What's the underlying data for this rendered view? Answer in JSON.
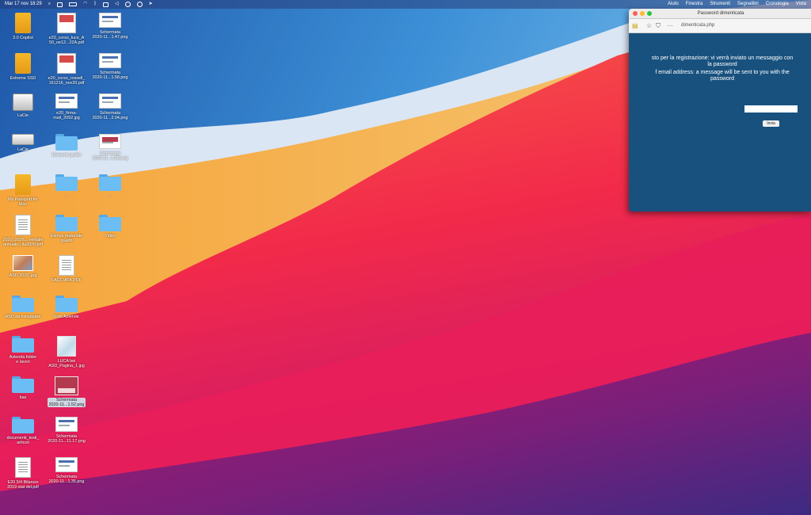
{
  "menubar": {
    "left_items": [
      {
        "name": "datetime",
        "label": "Mar 17 nov 18:29"
      },
      {
        "name": "spotlight-icon"
      },
      {
        "name": "control-center-icon"
      },
      {
        "name": "battery-icon"
      },
      {
        "name": "wifi-icon"
      },
      {
        "name": "bluetooth-icon"
      },
      {
        "name": "screen-mirror-icon"
      },
      {
        "name": "volume-icon"
      },
      {
        "name": "user-icon"
      },
      {
        "name": "focus-icon"
      },
      {
        "name": "location-icon"
      }
    ],
    "menus": [
      "Aiuto",
      "Finestra",
      "Strumenti",
      "Segnalibri",
      "Cronologia",
      "Vista"
    ]
  },
  "desktop_icons": [
    {
      "name": "icon-3d-copilot",
      "kind": "drive",
      "label": "3.0 Copilot"
    },
    {
      "name": "icon-extreme-ssd",
      "kind": "drive",
      "label": "Extreme SSD"
    },
    {
      "name": "icon-lacie-1",
      "kind": "lacie",
      "label": "LaCie"
    },
    {
      "name": "icon-lacie-2",
      "kind": "lacie2",
      "label": "LaCie"
    },
    {
      "name": "icon-my-passport",
      "kind": "drive",
      "label": "My Passport for\nMac"
    },
    {
      "name": "icon-verbale-pdf",
      "kind": "doc",
      "label": "2020_2026... verbale\nannuale...lla2020.pdf"
    },
    {
      "name": "icon-asd-2020-jpg",
      "kind": "photo",
      "label": "ASD 2020 .jpg"
    },
    {
      "name": "icon-asd-sviluppo",
      "kind": "folder",
      "label": "ASD da sviluppare"
    },
    {
      "name": "icon-azienda-folder",
      "kind": "folder",
      "label": "Azienda folder\ne lavori"
    },
    {
      "name": "icon-bas",
      "kind": "folder",
      "label": "bas"
    },
    {
      "name": "icon-documenti-testi",
      "kind": "folder",
      "label": "documenti_testi_\narticoli"
    },
    {
      "name": "icon-e20-bilancio",
      "kind": "doc",
      "label": "E20 5/4 Bilancio\n2019 stat del.pdf"
    },
    {
      "name": "icon-corso-luce-pdf",
      "kind": "pdf",
      "label": "e20_corso_luce_A\n50_oe12...22A.pdf"
    },
    {
      "name": "icon-corso-rossi-pdf",
      "kind": "pdf",
      "label": "e20_corso_rossell_\n161216_nov20.pdf"
    },
    {
      "name": "icon-firma-jpg",
      "kind": "shot",
      "label": "e20_firma-\nmail_2092.jpg"
    },
    {
      "name": "icon-elementi-grafici",
      "kind": "folder",
      "label": "Elementi grafici"
    },
    {
      "name": "icon-folder-a",
      "kind": "folder",
      "label": "..."
    },
    {
      "name": "icon-elenco-materiale",
      "kind": "folder",
      "label": "Elenco materiale\nquadri"
    },
    {
      "name": "icon-facciata-pdf",
      "kind": "doc",
      "label": "FACCIATA.PDF"
    },
    {
      "name": "icon-foto-aziende",
      "kind": "folder",
      "label": "Foto Aziende"
    },
    {
      "name": "icon-luca-pagina",
      "kind": "flyer",
      "label": "LUCA bei\nASD_Pagina_1.jpg"
    },
    {
      "name": "icon-schermata-selected",
      "kind": "bigshot",
      "label": "Schermata\n2020-11...1.52.png"
    },
    {
      "name": "icon-schermata-a",
      "kind": "shot",
      "label": "Schermata\n2020-11...11.17.png"
    },
    {
      "name": "icon-schermata-b",
      "kind": "shot",
      "label": "Schermata\n2020-11...1.35.png"
    },
    {
      "name": "icon-schermata-c",
      "kind": "shot",
      "label": "Schermata\n2020-11...1.47.png"
    },
    {
      "name": "icon-schermata-d",
      "kind": "shot",
      "label": "Schermata\n2020-11...1.58.png"
    },
    {
      "name": "icon-schermata-e",
      "kind": "shot",
      "label": "Schermata\n2020-11...2.04.png"
    },
    {
      "name": "icon-schermata-f",
      "kind": "shotred",
      "label": "Schermata\n2020-11...6.38.png"
    },
    {
      "name": "icon-folder-b",
      "kind": "folder",
      "label": "..."
    },
    {
      "name": "icon-video",
      "kind": "folder",
      "label": "Video"
    }
  ],
  "browser": {
    "window_title": "Password dimenticata",
    "url": "dimenticata.php",
    "message_it": "sto per la registrazione: vi verrà inviato un messaggio con\nla password",
    "message_en": "f email address: a message will be sent to you with the\npassword",
    "email_placeholder": "",
    "send_label": "Invia"
  },
  "colors": {
    "window_bg": "#18517e",
    "menubar_bg": "#2a3c78",
    "traffic_close": "#fe5f57",
    "traffic_min": "#febc2e",
    "traffic_max": "#28c840"
  }
}
